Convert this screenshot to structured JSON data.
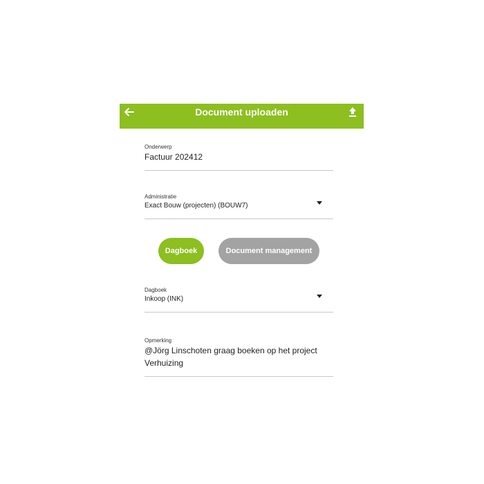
{
  "app": {
    "title": "Document uploaden",
    "accent_color": "#8cbf1f",
    "back_icon": "arrow-left-icon",
    "upload_icon": "upload-icon"
  },
  "form": {
    "onderwerp": {
      "label": "Onderwerp",
      "value": "Factuur 202412"
    },
    "administratie": {
      "label": "Administratie",
      "value": "Exact Bouw (projecten)  (BOUW7)"
    },
    "toggle": {
      "dagboek_label": "Dagboek",
      "document_management_label": "Document management",
      "selected": "Dagboek"
    },
    "dagboek": {
      "label": "Dagboek",
      "value": "Inkoop (INK)"
    },
    "opmerking": {
      "label": "Opmerking",
      "line1": "@Jörg Linschoten graag boeken op het project",
      "line2": "Verhuizing"
    }
  }
}
